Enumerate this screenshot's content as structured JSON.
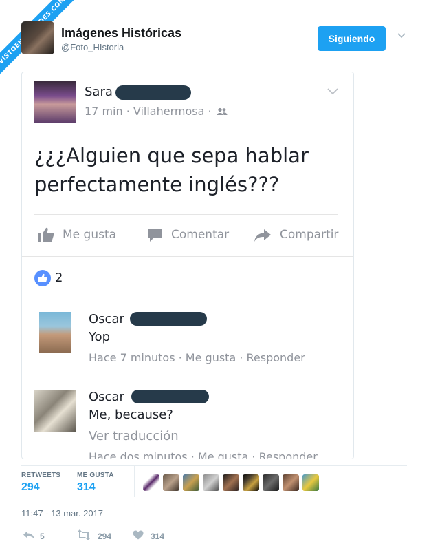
{
  "ribbon": {
    "text": "VISTOENLASREDES.COM"
  },
  "header": {
    "name": "Imágenes Históricas",
    "handle": "@Foto_HIstoria",
    "follow_label": "Siguiendo"
  },
  "fb_post": {
    "author": "Sara",
    "meta": "17 min · Villahermosa ·",
    "text": "¿¿¿Alguien que sepa hablar perfectamente inglés???",
    "actions": {
      "like": "Me gusta",
      "comment": "Comentar",
      "share": "Compartir"
    },
    "like_count": "2",
    "comments": [
      {
        "author": "Oscar",
        "text": "Yop",
        "meta": "Hace 7 minutos · Me gusta · Responder"
      },
      {
        "author": "Oscar",
        "text": "Me, because?",
        "translate": "Ver traducción",
        "meta": "Hace dos minutos · Me gusta · Responder"
      }
    ]
  },
  "stats": {
    "retweets_label": "RETWEETS",
    "retweets": "294",
    "likes_label": "ME GUSTA",
    "likes": "314"
  },
  "timestamp": "11:47 - 13 mar. 2017",
  "actions": {
    "replies": "5",
    "retweets": "294",
    "likes": "314"
  },
  "colors": {
    "accent": "#1da1f2",
    "fb_like": "#5890ff",
    "muted": "#657786"
  }
}
